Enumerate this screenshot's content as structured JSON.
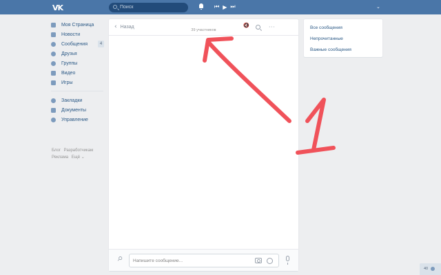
{
  "header": {
    "logo": "VK",
    "search_placeholder": "Поиск",
    "player_prev": "⏮",
    "player_play": "▶",
    "player_next": "⏭",
    "menu_chevron": "⌄"
  },
  "nav": {
    "items": [
      {
        "label": "Моя Страница",
        "icon": "home-icon"
      },
      {
        "label": "Новости",
        "icon": "news-icon"
      },
      {
        "label": "Сообщения",
        "icon": "messages-icon",
        "badge": "4"
      },
      {
        "label": "Друзья",
        "icon": "friends-icon"
      },
      {
        "label": "Группы",
        "icon": "groups-icon"
      },
      {
        "label": "Видео",
        "icon": "video-icon"
      },
      {
        "label": "Игры",
        "icon": "games-icon"
      }
    ],
    "items2": [
      {
        "label": "Закладки",
        "icon": "star-icon"
      },
      {
        "label": "Документы",
        "icon": "document-icon"
      },
      {
        "label": "Управление",
        "icon": "manage-icon"
      }
    ],
    "footer": [
      "Блог",
      "Разработчикам",
      "Реклама",
      "Ещё ⌄"
    ]
  },
  "chat": {
    "back_label": "Назад",
    "back_arrow": "‹",
    "members": "39 участников",
    "mute_glyph": "🔇",
    "more_glyph": "···",
    "input_placeholder": "Напишите сообщение..."
  },
  "filters": {
    "items": [
      "Все сообщения",
      "Непрочитанные",
      "Важные сообщения"
    ]
  },
  "corner": {
    "count": "40"
  },
  "annotation": {
    "text": "1",
    "color": "#f0525a"
  }
}
